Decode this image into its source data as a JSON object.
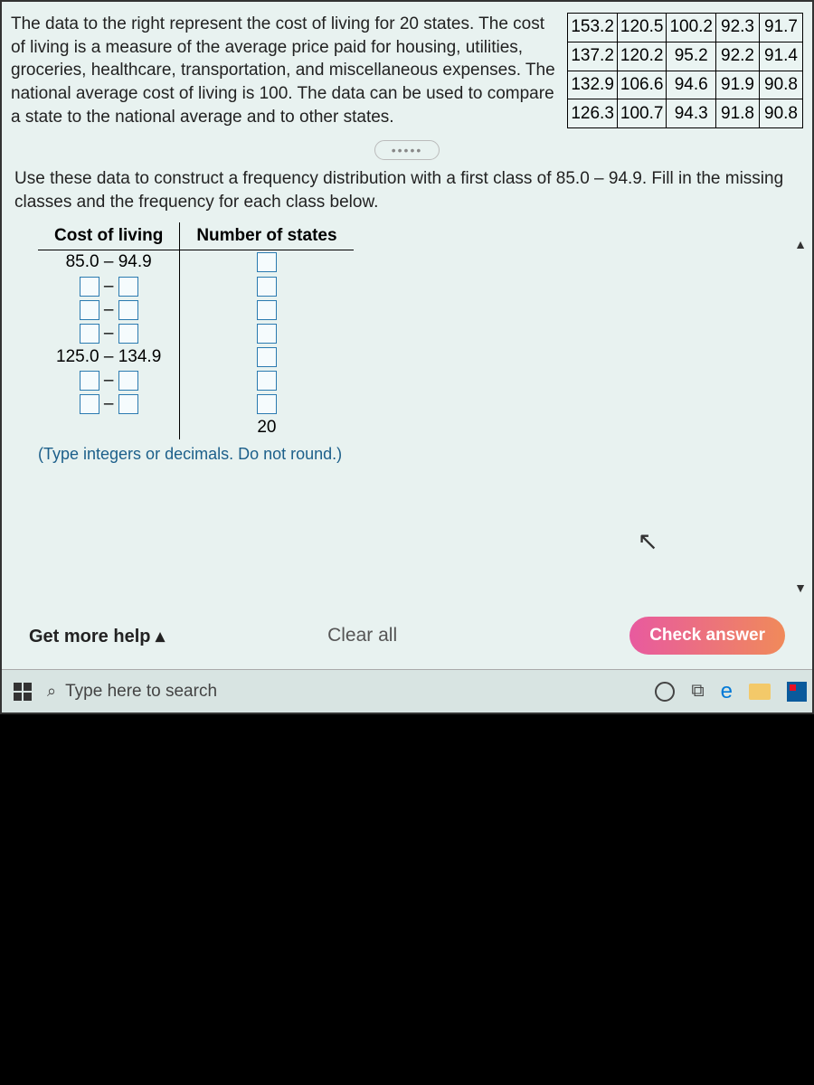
{
  "problem": {
    "text": "The data to the right represent the cost of living for 20 states. The cost of living is a measure of the average price paid for housing, utilities, groceries, healthcare, transportation, and miscellaneous expenses. The national average cost of living is 100. The data can be used to compare a state to the national average and to other states."
  },
  "data_table": {
    "rows": [
      [
        "153.2",
        "120.5",
        "100.2",
        "92.3",
        "91.7"
      ],
      [
        "137.2",
        "120.2",
        "95.2",
        "92.2",
        "91.4"
      ],
      [
        "132.9",
        "106.6",
        "94.6",
        "91.9",
        "90.8"
      ],
      [
        "126.3",
        "100.7",
        "94.3",
        "91.8",
        "90.8"
      ]
    ]
  },
  "instruction": "Use these data to construct a frequency distribution with a first class of 85.0 – 94.9. Fill in the missing classes and the frequency for each class below.",
  "freq_table": {
    "headers": [
      "Cost of living",
      "Number of states"
    ],
    "rows": [
      {
        "class_label": "85.0 – 94.9",
        "editable_class": false
      },
      {
        "class_label": "",
        "editable_class": true
      },
      {
        "class_label": "",
        "editable_class": true
      },
      {
        "class_label": "",
        "editable_class": true
      },
      {
        "class_label": "125.0 – 134.9",
        "editable_class": false
      },
      {
        "class_label": "",
        "editable_class": true
      },
      {
        "class_label": "",
        "editable_class": true
      }
    ],
    "total": "20"
  },
  "hint": "(Type integers or decimals. Do not round.)",
  "buttons": {
    "help": "Get more help",
    "clear": "Clear all",
    "check": "Check answer"
  },
  "taskbar": {
    "search_placeholder": "Type here to search"
  }
}
